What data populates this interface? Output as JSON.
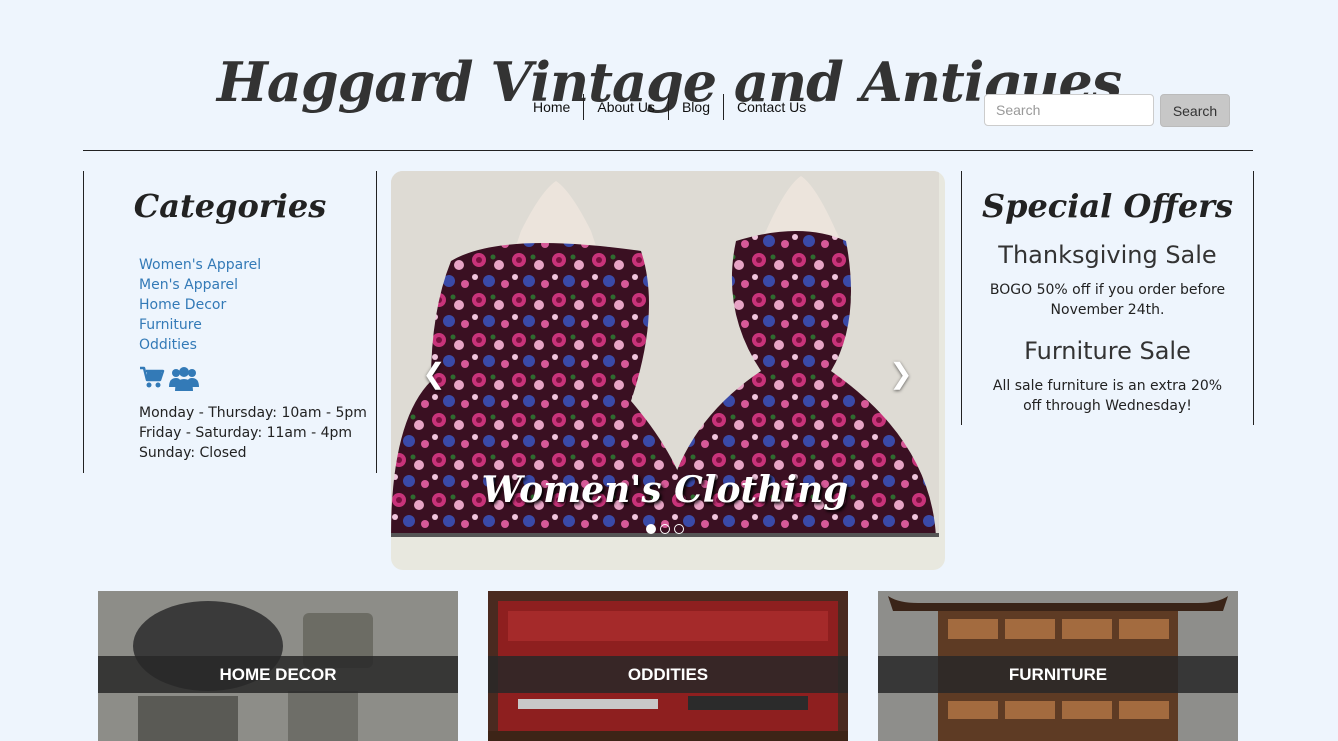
{
  "site": {
    "title": "Haggard Vintage and Antiques"
  },
  "nav": [
    "Home",
    "About Us",
    "Blog",
    "Contact Us"
  ],
  "search": {
    "placeholder": "Search",
    "button": "Search"
  },
  "categories": {
    "heading": "Categories",
    "items": [
      "Women's Apparel",
      "Men's Apparel",
      "Home Decor",
      "Furniture",
      "Oddities"
    ],
    "icons": [
      "shopping-cart-icon",
      "users-icon"
    ],
    "hours": [
      "Monday - Thursday: 10am - 5pm",
      "Friday - Saturday: 11am - 4pm",
      "Sunday: Closed"
    ]
  },
  "carousel": {
    "caption": "Women's Clothing",
    "prev_icon": "chevron-left-icon",
    "next_icon": "chevron-right-icon",
    "slide_count": 3,
    "active_index": 0
  },
  "offers": {
    "heading": "Special Offers",
    "items": [
      {
        "title": "Thanksgiving Sale",
        "text": "BOGO 50% off if you order before November 24th."
      },
      {
        "title": "Furniture Sale",
        "text": "All sale furniture is an extra 20% off through Wednesday!"
      }
    ]
  },
  "tiles": [
    "HOME DECOR",
    "ODDITIES",
    "FURNITURE"
  ],
  "colors": {
    "background": "#eef5fd",
    "link": "#337ab7",
    "icon": "#337ab7"
  }
}
